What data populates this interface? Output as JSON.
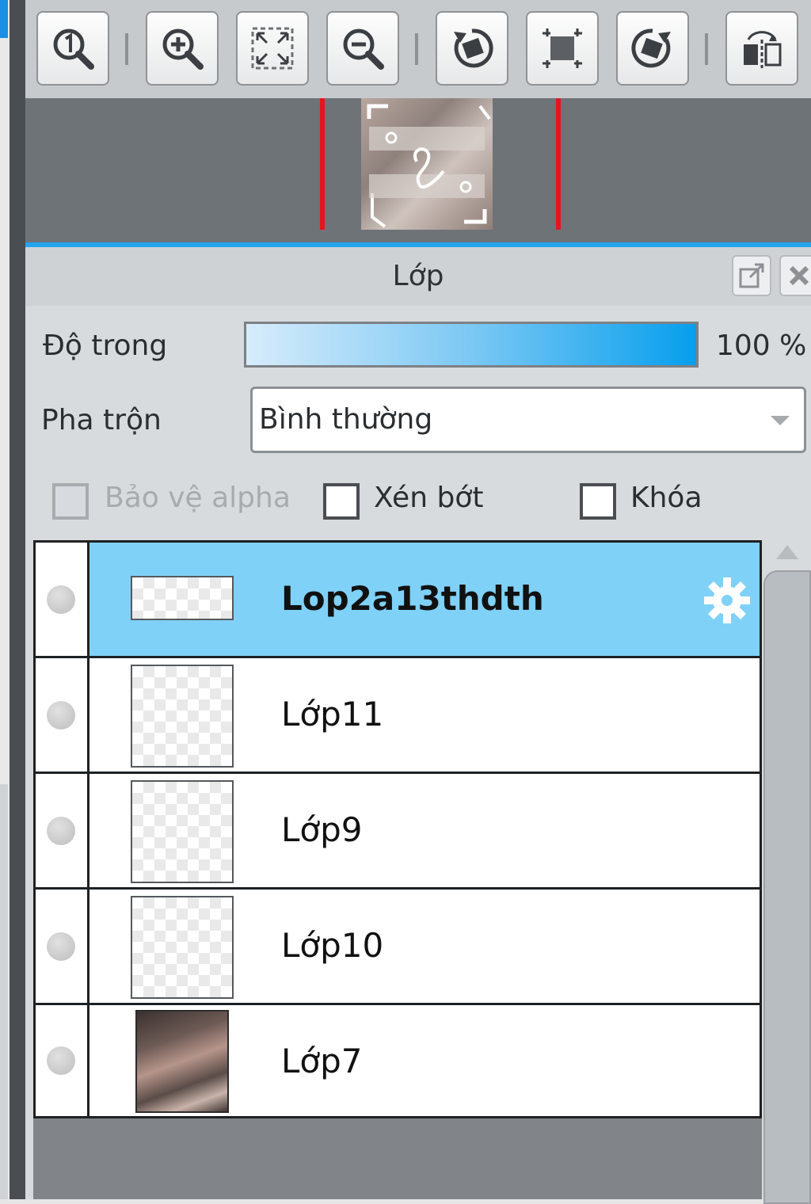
{
  "toolbar": {
    "buttons": [
      {
        "name": "zoom-actual-size",
        "icon": "zoom-100-icon"
      },
      {
        "name": "zoom-in",
        "icon": "zoom-in-icon"
      },
      {
        "name": "fit-window",
        "icon": "fit-window-icon"
      },
      {
        "name": "zoom-out",
        "icon": "zoom-out-icon"
      },
      {
        "name": "rotate-left",
        "icon": "rotate-left-icon"
      },
      {
        "name": "reset-rotation",
        "icon": "reset-view-icon"
      },
      {
        "name": "rotate-right",
        "icon": "rotate-right-icon"
      },
      {
        "name": "flip-horizontal",
        "icon": "flip-horizontal-icon"
      }
    ]
  },
  "layers_panel": {
    "title": "Lớp",
    "opacity_label": "Độ trong",
    "opacity_value": "100 %",
    "opacity_level": 1.0,
    "blend_label": "Pha trộn",
    "blend_value": "Bình thường",
    "protect_alpha_label": "Bảo vệ alpha",
    "clipping_label": "Xén bớt",
    "lock_label": "Khóa",
    "layers": [
      {
        "name": "Lop2a13thdth",
        "selected": true,
        "thumb": "transparent-wide"
      },
      {
        "name": "Lớp11",
        "selected": false,
        "thumb": "transparent"
      },
      {
        "name": "Lớp9",
        "selected": false,
        "thumb": "transparent"
      },
      {
        "name": "Lớp10",
        "selected": false,
        "thumb": "transparent"
      },
      {
        "name": "Lớp7",
        "selected": false,
        "thumb": "photo"
      }
    ]
  },
  "colors": {
    "selection": "#7fd1f8",
    "accent": "#24a3ee",
    "navigator_frame": "#e8141c"
  }
}
